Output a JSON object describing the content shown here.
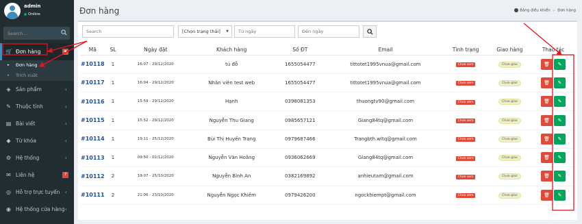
{
  "user": {
    "name": "admin",
    "status": "Online"
  },
  "sidebar": {
    "search_placeholder": "Search...",
    "items": [
      {
        "label": "Đơn hàng",
        "icon": "cart-icon",
        "badge": ""
      },
      {
        "label": "Sản phẩm",
        "icon": "box-icon"
      },
      {
        "label": "Thuộc tính",
        "icon": "tags-icon"
      },
      {
        "label": "Bài viết",
        "icon": "file-icon"
      },
      {
        "label": "Từ khóa",
        "icon": "tag-icon"
      },
      {
        "label": "Hệ thống",
        "icon": "gear-icon"
      },
      {
        "label": "Liên hệ",
        "icon": "phone-icon",
        "badge": "7"
      },
      {
        "label": "Hỗ trợ trực tuyến",
        "icon": "globe-icon"
      },
      {
        "label": "Hệ thống cửa hàng",
        "icon": "store-icon"
      }
    ],
    "sub_items": [
      {
        "label": "Đơn hàng"
      },
      {
        "label": "Trích xuất"
      }
    ]
  },
  "header": {
    "title": "Đơn hàng",
    "breadcrumb": [
      "Bảng điều khiển",
      "Đơn hàng"
    ]
  },
  "filters": {
    "search_placeholder": "Search",
    "status_select": "[Chọn trạng thái]",
    "from_placeholder": "Từ ngày",
    "to_placeholder": "Đến ngày"
  },
  "table": {
    "columns": [
      "Mã",
      "SL",
      "Ngày đặt",
      "Khách hàng",
      "Số ĐT",
      "Email",
      "Tình trạng",
      "Giao hàng",
      "Thao tác"
    ],
    "rows": [
      {
        "id": "#10118",
        "qty": "1",
        "date": "16:07 - 29/12/2020",
        "customer": "tú đỗ",
        "phone": "1655054477",
        "email": "tittotet1995vnua@gmail.com",
        "status": "Chưa xem",
        "ship": "Chưa giao"
      },
      {
        "id": "#10117",
        "qty": "1",
        "date": "16:04 - 29/12/2020",
        "customer": "Nhân viên test web",
        "phone": "1655054477",
        "email": "tittotet1995vnua@gmail.com",
        "status": "Chưa xem",
        "ship": "Chưa giao"
      },
      {
        "id": "#10116",
        "qty": "1",
        "date": "15:59 - 29/12/2020",
        "customer": "Hạnh",
        "phone": "0398081353",
        "email": "thuongtv90@gmail.com",
        "status": "Chưa xem",
        "ship": "Chưa giao"
      },
      {
        "id": "#10115",
        "qty": "1",
        "date": "15:52 - 29/12/2020",
        "customer": "Nguyễn Thu Giang",
        "phone": "0985657121",
        "email": "Giang84tq@gmail.com",
        "status": "Chưa xem",
        "ship": "Chưa giao"
      },
      {
        "id": "#10114",
        "qty": "1",
        "date": "19:11 - 25/12/2020",
        "customer": "Bùi Thị Huyền Trang",
        "phone": "0979687466",
        "email": "Trangbth.wltq@gmail.com",
        "status": "Chưa xem",
        "ship": "Chưa giao"
      },
      {
        "id": "#10113",
        "qty": "1",
        "date": "09:50 - 02/12/2020",
        "customer": "Nguyễn Văn Hoằng",
        "phone": "0936062669",
        "email": "Giang84tq@gmail.com",
        "status": "Chưa xem",
        "ship": "Chưa giao"
      },
      {
        "id": "#10112",
        "qty": "2",
        "date": "19:07 - 25/10/2020",
        "customer": "Nguyễn Bình An",
        "phone": "0382169892",
        "email": "anhieutam@gmail.com",
        "status": "Chưa xem",
        "ship": "Chưa giao"
      },
      {
        "id": "#10111",
        "qty": "2",
        "date": "21:06 - 23/10/2020",
        "customer": "Nguyễn Ngọc Khiêm",
        "phone": "0979426200",
        "email": "ngockhiempt@gmail.com",
        "status": "Chưa xem",
        "ship": "Chưa giao"
      }
    ]
  },
  "colors": {
    "sidebar": "#222d32",
    "accent": "#3c8dbc",
    "danger": "#dd4b39",
    "success": "#00a65a",
    "annotation": "#e8131b"
  }
}
